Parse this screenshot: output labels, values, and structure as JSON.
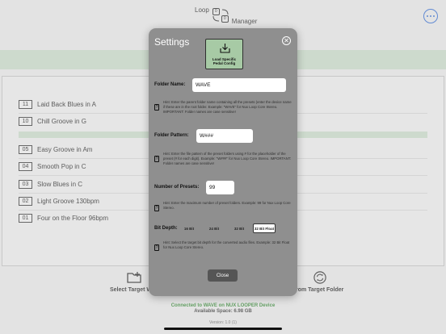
{
  "app": {
    "title_part1": "Loop",
    "title_icon_a": "0",
    "title_icon_b": "0",
    "title_part2": "Manager",
    "presets": [
      {
        "num": "11",
        "name": "Laid Back Blues in A"
      },
      {
        "num": "10",
        "name": "Chill Groove in G"
      },
      {
        "num": "05",
        "name": "Easy Groove in Am"
      },
      {
        "num": "04",
        "name": "Smooth Pop in C"
      },
      {
        "num": "03",
        "name": "Slow Blues in C"
      },
      {
        "num": "02",
        "name": "Light Groove 130bpm"
      },
      {
        "num": "01",
        "name": "Four on the Floor 96bpm"
      }
    ],
    "select_target_label": "Select Target WAV",
    "from_target_label": "rom Target Folder",
    "status_connected": "Connected to WAVE on NUX LOOPER Device",
    "status_space": "Available Space: 6.98 GB",
    "version": "Version: 1.0 (1)"
  },
  "settings": {
    "title": "Settings",
    "load_button_line1": "Load Specific",
    "load_button_line2": "Pedal Config",
    "folder_name_label": "Folder Name:",
    "folder_name_value": "WAVE",
    "folder_name_hint": "Hint: Enter the parent folder name containing all the presets (enter the device name if these are in the root folder. Example: \"WAVE\" for Nux Loop Core Stereo. IMPORTANT: Folder names are case sensitive!",
    "folder_pattern_label": "Folder Pattern:",
    "folder_pattern_value": "W###",
    "folder_pattern_hint": "Hint: Enter the file pattern of the preset folders using # for the placeholder of the preset (# for each digit). Example: \"W###\" for Nux Loop Core Stereo. IMPORTANT: Folder names are case sensitive!",
    "presets_label": "Number of Presets:",
    "presets_value": "99",
    "presets_hint": "Hint: Enter the maximum number of preset folders. Example: 99 for Nux Loop Core Stereo.",
    "bit_depth_label": "Bit Depth:",
    "bit_options": [
      "16 Bit",
      "24 Bit",
      "32 Bit",
      "32 Bit Float"
    ],
    "bit_selected": "32 Bit Float",
    "bit_depth_hint": "Hint: Select the target bit depth for the converted audio files. Example: 32 Bit Float for Nux Loop Core Stereo.",
    "close_label": "Close"
  },
  "colors": {
    "accent_blue": "#2b6ad9",
    "status_green": "#2e8b2e",
    "modal_bg": "#8f8f8f",
    "load_button_bg": "#a7caa5"
  }
}
